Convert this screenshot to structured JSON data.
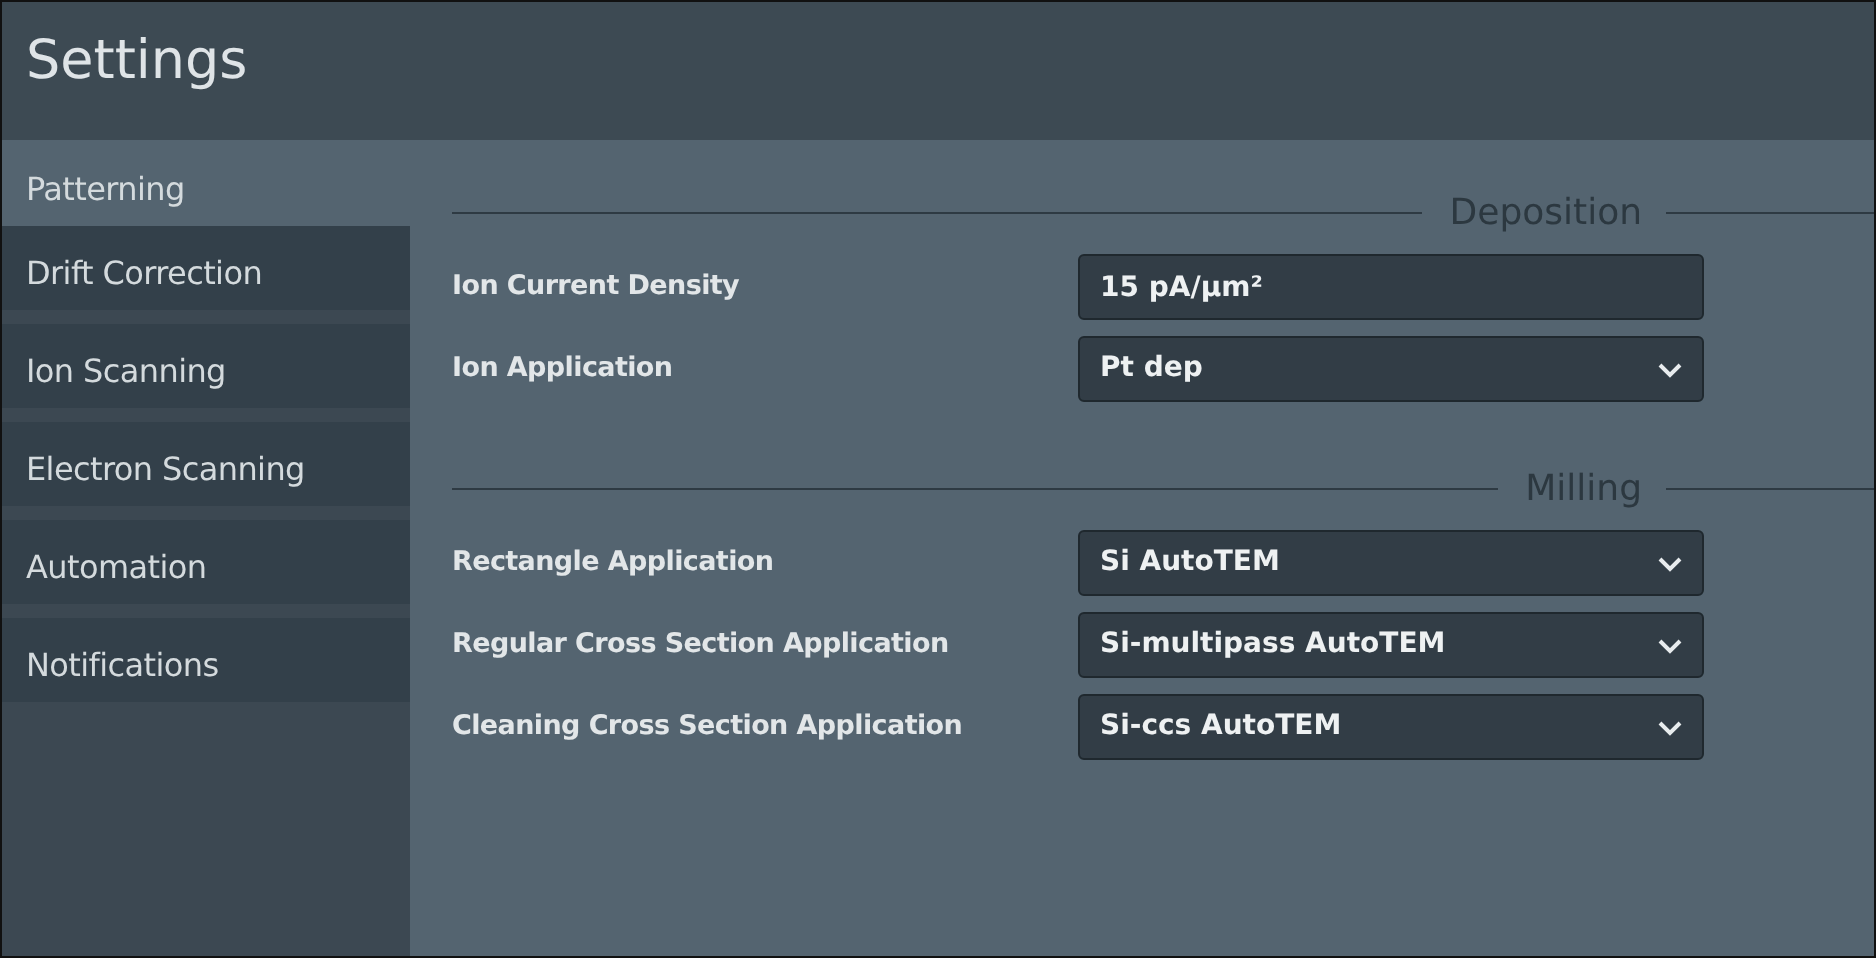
{
  "window": {
    "title": "Settings"
  },
  "sidebar": {
    "items": [
      {
        "label": "Patterning",
        "selected": true
      },
      {
        "label": "Drift Correction",
        "selected": false
      },
      {
        "label": "Ion Scanning",
        "selected": false
      },
      {
        "label": "Electron Scanning",
        "selected": false
      },
      {
        "label": "Automation",
        "selected": false
      },
      {
        "label": "Notifications",
        "selected": false
      }
    ]
  },
  "sections": [
    {
      "title": "Deposition",
      "rows": [
        {
          "label": "Ion Current Density",
          "kind": "text",
          "value": "15 pA/µm²"
        },
        {
          "label": "Ion Application",
          "kind": "select",
          "value": "Pt dep"
        }
      ]
    },
    {
      "title": "Milling",
      "rows": [
        {
          "label": "Rectangle Application",
          "kind": "select",
          "value": "Si AutoTEM"
        },
        {
          "label": "Regular Cross Section Application",
          "kind": "select",
          "value": "Si-multipass AutoTEM"
        },
        {
          "label": "Cleaning Cross Section Application",
          "kind": "select",
          "value": "Si-ccs AutoTEM"
        }
      ]
    }
  ]
}
